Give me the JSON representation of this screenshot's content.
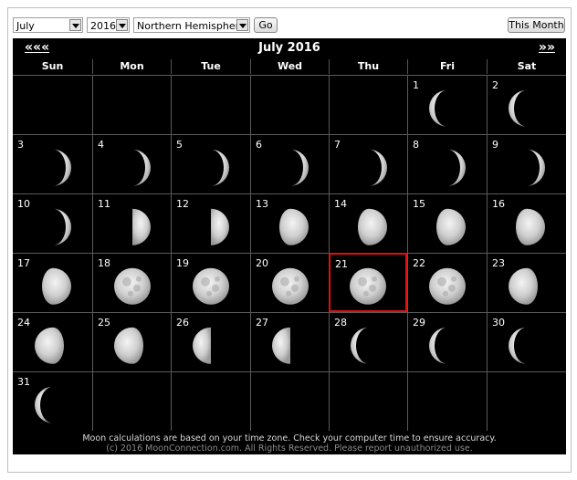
{
  "controls": {
    "month_value": "July",
    "year_value": "2016",
    "hemisphere_value": "Northern Hemisphere",
    "go_label": "Go",
    "this_month_label": "This Month"
  },
  "calendar": {
    "title": "July 2016",
    "prev_label": "«««",
    "next_label": "»»",
    "weekdays": [
      "Sun",
      "Mon",
      "Tue",
      "Wed",
      "Thu",
      "Fri",
      "Sat"
    ],
    "highlighted_day": "21",
    "days": [
      {
        "day": "1",
        "phase": "waning crescent"
      },
      {
        "day": "2",
        "phase": "waning crescent"
      },
      {
        "day": "3",
        "phase": "waxing crescent"
      },
      {
        "day": "4",
        "phase": "waxing crescent"
      },
      {
        "day": "5",
        "phase": "waxing crescent"
      },
      {
        "day": "6",
        "phase": "waxing crescent"
      },
      {
        "day": "7",
        "phase": "waxing crescent"
      },
      {
        "day": "8",
        "phase": "waxing crescent"
      },
      {
        "day": "9",
        "phase": "waxing crescent"
      },
      {
        "day": "10",
        "phase": "waxing crescent"
      },
      {
        "day": "11",
        "phase": "first quarter"
      },
      {
        "day": "12",
        "phase": "first quarter"
      },
      {
        "day": "13",
        "phase": "waxing gibbous"
      },
      {
        "day": "14",
        "phase": "waxing gibbous"
      },
      {
        "day": "15",
        "phase": "waxing gibbous"
      },
      {
        "day": "16",
        "phase": "waxing gibbous"
      },
      {
        "day": "17",
        "phase": "waxing gibbous"
      },
      {
        "day": "18",
        "phase": "full"
      },
      {
        "day": "19",
        "phase": "full"
      },
      {
        "day": "20",
        "phase": "full"
      },
      {
        "day": "21",
        "phase": "full"
      },
      {
        "day": "22",
        "phase": "full"
      },
      {
        "day": "23",
        "phase": "waning gibbous"
      },
      {
        "day": "24",
        "phase": "waning gibbous"
      },
      {
        "day": "25",
        "phase": "waning gibbous"
      },
      {
        "day": "26",
        "phase": "last quarter"
      },
      {
        "day": "27",
        "phase": "last quarter"
      },
      {
        "day": "28",
        "phase": "waning crescent"
      },
      {
        "day": "29",
        "phase": "waning crescent"
      },
      {
        "day": "30",
        "phase": "waning crescent"
      },
      {
        "day": "31",
        "phase": "waning crescent"
      }
    ]
  },
  "footer": {
    "line1": "Moon calculations are based on your time zone. Check your computer time to ensure accuracy.",
    "line2": "(c) 2016 MoonConnection.com. All Rights Reserved. Please report unauthorized use."
  },
  "colors": {
    "highlight": "#e01010",
    "background": "#000000"
  }
}
